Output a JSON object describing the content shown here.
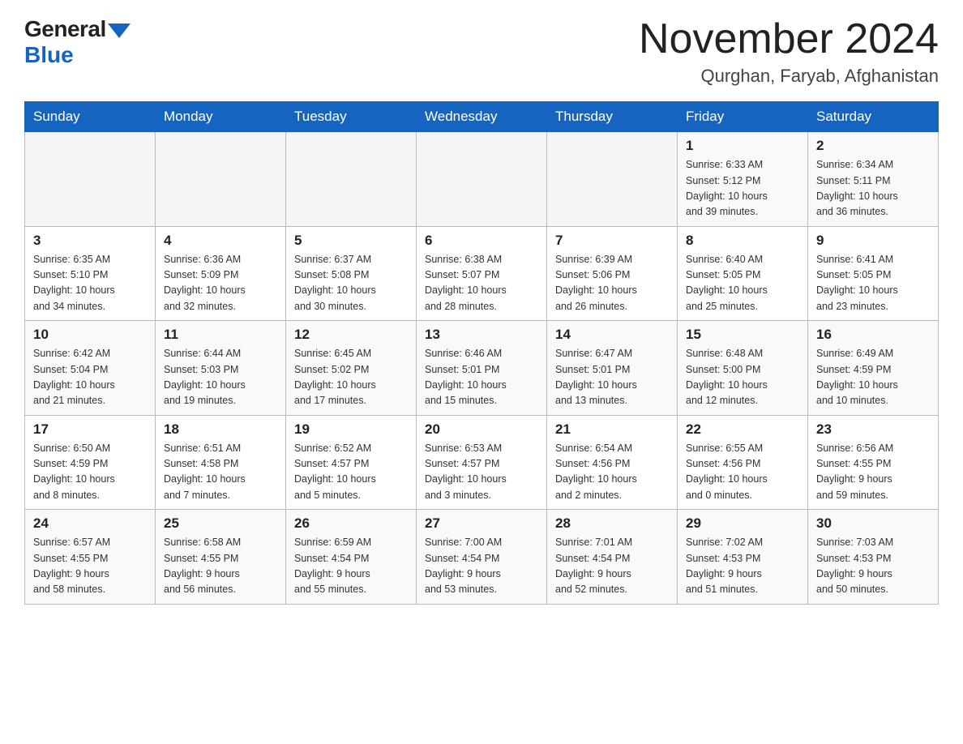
{
  "header": {
    "logo_general": "General",
    "logo_blue": "Blue",
    "month_title": "November 2024",
    "location": "Qurghan, Faryab, Afghanistan"
  },
  "days_of_week": [
    "Sunday",
    "Monday",
    "Tuesday",
    "Wednesday",
    "Thursday",
    "Friday",
    "Saturday"
  ],
  "weeks": [
    [
      {
        "day": "",
        "info": ""
      },
      {
        "day": "",
        "info": ""
      },
      {
        "day": "",
        "info": ""
      },
      {
        "day": "",
        "info": ""
      },
      {
        "day": "",
        "info": ""
      },
      {
        "day": "1",
        "info": "Sunrise: 6:33 AM\nSunset: 5:12 PM\nDaylight: 10 hours\nand 39 minutes."
      },
      {
        "day": "2",
        "info": "Sunrise: 6:34 AM\nSunset: 5:11 PM\nDaylight: 10 hours\nand 36 minutes."
      }
    ],
    [
      {
        "day": "3",
        "info": "Sunrise: 6:35 AM\nSunset: 5:10 PM\nDaylight: 10 hours\nand 34 minutes."
      },
      {
        "day": "4",
        "info": "Sunrise: 6:36 AM\nSunset: 5:09 PM\nDaylight: 10 hours\nand 32 minutes."
      },
      {
        "day": "5",
        "info": "Sunrise: 6:37 AM\nSunset: 5:08 PM\nDaylight: 10 hours\nand 30 minutes."
      },
      {
        "day": "6",
        "info": "Sunrise: 6:38 AM\nSunset: 5:07 PM\nDaylight: 10 hours\nand 28 minutes."
      },
      {
        "day": "7",
        "info": "Sunrise: 6:39 AM\nSunset: 5:06 PM\nDaylight: 10 hours\nand 26 minutes."
      },
      {
        "day": "8",
        "info": "Sunrise: 6:40 AM\nSunset: 5:05 PM\nDaylight: 10 hours\nand 25 minutes."
      },
      {
        "day": "9",
        "info": "Sunrise: 6:41 AM\nSunset: 5:05 PM\nDaylight: 10 hours\nand 23 minutes."
      }
    ],
    [
      {
        "day": "10",
        "info": "Sunrise: 6:42 AM\nSunset: 5:04 PM\nDaylight: 10 hours\nand 21 minutes."
      },
      {
        "day": "11",
        "info": "Sunrise: 6:44 AM\nSunset: 5:03 PM\nDaylight: 10 hours\nand 19 minutes."
      },
      {
        "day": "12",
        "info": "Sunrise: 6:45 AM\nSunset: 5:02 PM\nDaylight: 10 hours\nand 17 minutes."
      },
      {
        "day": "13",
        "info": "Sunrise: 6:46 AM\nSunset: 5:01 PM\nDaylight: 10 hours\nand 15 minutes."
      },
      {
        "day": "14",
        "info": "Sunrise: 6:47 AM\nSunset: 5:01 PM\nDaylight: 10 hours\nand 13 minutes."
      },
      {
        "day": "15",
        "info": "Sunrise: 6:48 AM\nSunset: 5:00 PM\nDaylight: 10 hours\nand 12 minutes."
      },
      {
        "day": "16",
        "info": "Sunrise: 6:49 AM\nSunset: 4:59 PM\nDaylight: 10 hours\nand 10 minutes."
      }
    ],
    [
      {
        "day": "17",
        "info": "Sunrise: 6:50 AM\nSunset: 4:59 PM\nDaylight: 10 hours\nand 8 minutes."
      },
      {
        "day": "18",
        "info": "Sunrise: 6:51 AM\nSunset: 4:58 PM\nDaylight: 10 hours\nand 7 minutes."
      },
      {
        "day": "19",
        "info": "Sunrise: 6:52 AM\nSunset: 4:57 PM\nDaylight: 10 hours\nand 5 minutes."
      },
      {
        "day": "20",
        "info": "Sunrise: 6:53 AM\nSunset: 4:57 PM\nDaylight: 10 hours\nand 3 minutes."
      },
      {
        "day": "21",
        "info": "Sunrise: 6:54 AM\nSunset: 4:56 PM\nDaylight: 10 hours\nand 2 minutes."
      },
      {
        "day": "22",
        "info": "Sunrise: 6:55 AM\nSunset: 4:56 PM\nDaylight: 10 hours\nand 0 minutes."
      },
      {
        "day": "23",
        "info": "Sunrise: 6:56 AM\nSunset: 4:55 PM\nDaylight: 9 hours\nand 59 minutes."
      }
    ],
    [
      {
        "day": "24",
        "info": "Sunrise: 6:57 AM\nSunset: 4:55 PM\nDaylight: 9 hours\nand 58 minutes."
      },
      {
        "day": "25",
        "info": "Sunrise: 6:58 AM\nSunset: 4:55 PM\nDaylight: 9 hours\nand 56 minutes."
      },
      {
        "day": "26",
        "info": "Sunrise: 6:59 AM\nSunset: 4:54 PM\nDaylight: 9 hours\nand 55 minutes."
      },
      {
        "day": "27",
        "info": "Sunrise: 7:00 AM\nSunset: 4:54 PM\nDaylight: 9 hours\nand 53 minutes."
      },
      {
        "day": "28",
        "info": "Sunrise: 7:01 AM\nSunset: 4:54 PM\nDaylight: 9 hours\nand 52 minutes."
      },
      {
        "day": "29",
        "info": "Sunrise: 7:02 AM\nSunset: 4:53 PM\nDaylight: 9 hours\nand 51 minutes."
      },
      {
        "day": "30",
        "info": "Sunrise: 7:03 AM\nSunset: 4:53 PM\nDaylight: 9 hours\nand 50 minutes."
      }
    ]
  ]
}
